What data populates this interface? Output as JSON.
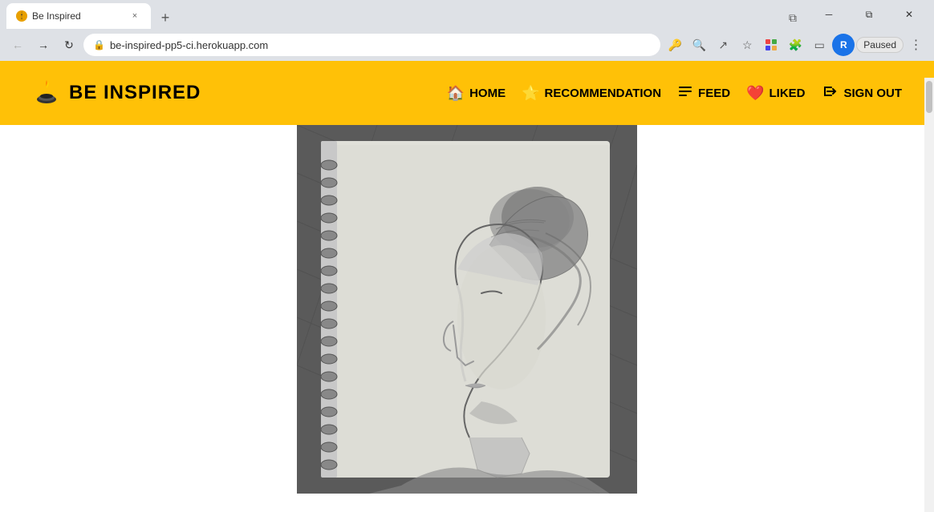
{
  "browser": {
    "tab_favicon": "🕯",
    "tab_label": "Be Inspired",
    "tab_close": "×",
    "new_tab_icon": "+",
    "nav_back": "←",
    "nav_forward": "→",
    "nav_refresh": "↻",
    "lock_icon": "🔒",
    "address": "be-inspired-pp5-ci.herokuapp.com",
    "toolbar": {
      "key_icon": "🔑",
      "zoom_icon": "🔍",
      "share_icon": "↗",
      "star_icon": "☆",
      "ext1_icon": "🧩",
      "ext2_icon": "🧩",
      "sidebar_icon": "▭",
      "profile_label": "R",
      "paused_label": "Paused",
      "more_icon": "⋮"
    },
    "scrollbar_visible": true
  },
  "navbar": {
    "brand_name": "BE INSPIRED",
    "links": [
      {
        "id": "home",
        "label": "HOME",
        "icon": "🏠",
        "icon_type": "home"
      },
      {
        "id": "recommendation",
        "label": "RECOMMENDATION",
        "icon": "⭐",
        "icon_type": "star"
      },
      {
        "id": "feed",
        "label": "FEED",
        "icon": "📡",
        "icon_type": "feed"
      },
      {
        "id": "liked",
        "label": "LIKED",
        "icon": "❤️",
        "icon_type": "heart"
      },
      {
        "id": "signout",
        "label": "SIGN OUT",
        "icon": "🚪",
        "icon_type": "signout"
      }
    ]
  },
  "main": {
    "image_alt": "Pencil sketch of woman in profile view on spiral notebook"
  }
}
